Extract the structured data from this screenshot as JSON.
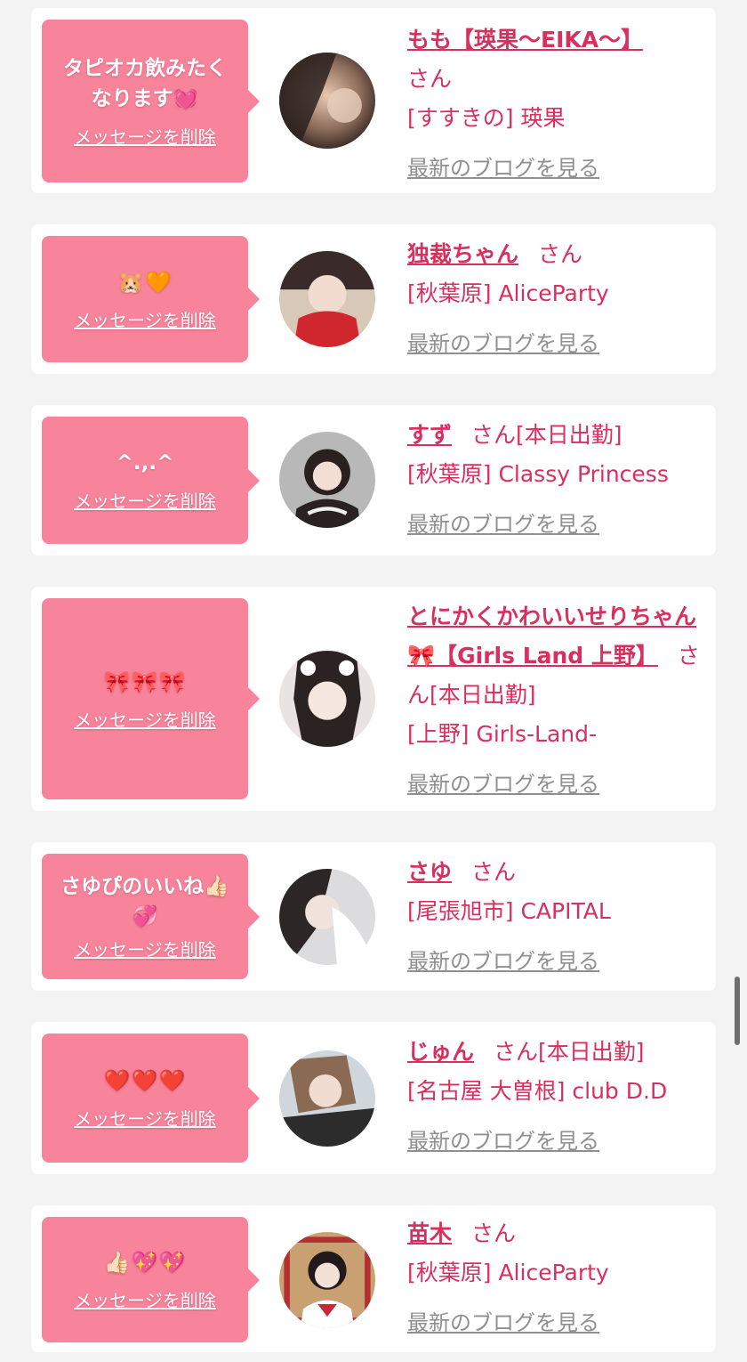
{
  "delete_label": "メッセージを削除",
  "san_label": "さん",
  "blog_label": "最新のブログを見る",
  "colors": {
    "bubble": "#f7849b",
    "name": "#d92f5e",
    "link_gray": "#8f8f8f",
    "background": "#f3f3f3"
  },
  "entries": [
    {
      "message_lines": [
        "タピオカ飲みたく",
        "なります💓"
      ],
      "name": "もも【瑛果〜EIKA〜】",
      "status": "",
      "shop": "[すすきの] 瑛果"
    },
    {
      "message_lines": [
        "🐹🧡"
      ],
      "name": "独裁ちゃん",
      "status": "",
      "shop": "[秋葉原] AliceParty"
    },
    {
      "message_lines": [
        "^.,.^"
      ],
      "name": "すず",
      "status": "[本日出勤]",
      "shop": "[秋葉原] Classy Princess"
    },
    {
      "message_lines": [
        "🎀🎀🎀"
      ],
      "name": "とにかくかわいいせりちゃん🎀【Girls Land 上野】",
      "status": "[本日出勤]",
      "shop": "[上野] Girls-Land-"
    },
    {
      "message_lines": [
        "さゆぴのいいね👍🏻",
        "💞"
      ],
      "name": "さゆ",
      "status": "",
      "shop": "[尾張旭市] CAPITAL"
    },
    {
      "message_lines": [
        "❤️❤️❤️"
      ],
      "name": "じゅん",
      "status": "[本日出勤]",
      "shop": "[名古屋 大曽根] club D.D"
    },
    {
      "message_lines": [
        "👍🏻💖💖"
      ],
      "name": "苗木",
      "status": "",
      "shop": "[秋葉原] AliceParty"
    }
  ]
}
